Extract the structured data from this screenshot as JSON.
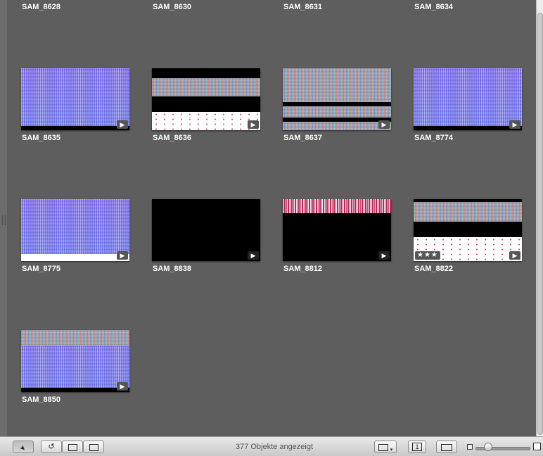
{
  "photos": {
    "top_row_captions": [
      "SAM_8628",
      "SAM_8630",
      "SAM_8631",
      "SAM_8634"
    ],
    "items": [
      {
        "name": "SAM_8635",
        "type": "video",
        "rating": ""
      },
      {
        "name": "SAM_8636",
        "type": "video",
        "rating": ""
      },
      {
        "name": "SAM_8637",
        "type": "video",
        "rating": ""
      },
      {
        "name": "SAM_8774",
        "type": "video",
        "rating": ""
      },
      {
        "name": "SAM_8775",
        "type": "video",
        "rating": ""
      },
      {
        "name": "SAM_8838",
        "type": "video",
        "rating": ""
      },
      {
        "name": "SAM_8812",
        "type": "video",
        "rating": ""
      },
      {
        "name": "SAM_8822",
        "type": "video",
        "rating": "★★★"
      },
      {
        "name": "SAM_8850",
        "type": "video",
        "rating": ""
      }
    ]
  },
  "icons": {
    "video": "▶",
    "pointer": "➤",
    "rotate": "↺"
  },
  "status": {
    "text": "377 Objekte angezeigt"
  },
  "toolbar": {
    "one_up_label": "1"
  },
  "colors": {
    "background": "#5e5e5e",
    "caption": "#ffffff",
    "toolbar": "#d9d9d9"
  }
}
